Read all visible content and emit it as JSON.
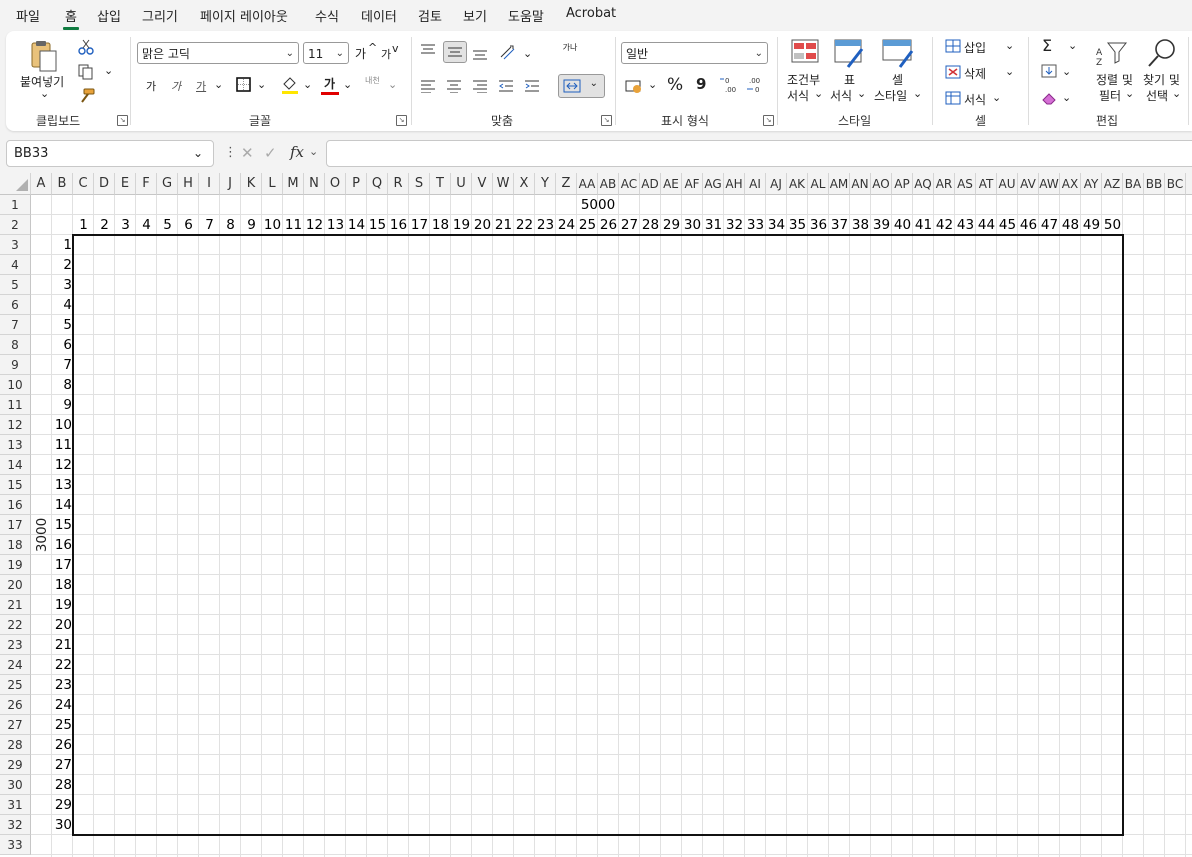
{
  "menu": {
    "tabs": [
      "파일",
      "홈",
      "삽입",
      "그리기",
      "페이지 레이아웃",
      "수식",
      "데이터",
      "검토",
      "보기",
      "도움말",
      "Acrobat"
    ],
    "active": "홈"
  },
  "ribbon": {
    "clipboard": {
      "paste_label": "붙여넣기",
      "group_label": "클립보드"
    },
    "font": {
      "font_name": "맑은 고딕",
      "font_size": "11",
      "bold": "가",
      "italic": "가",
      "underline": "가",
      "grow": "가",
      "shrink": "가",
      "color_glyph": "가",
      "phonetic": "내천",
      "group_label": "글꼴"
    },
    "alignment": {
      "wrap_glyph": "가나",
      "group_label": "맞춤"
    },
    "number": {
      "format": "일반",
      "percent": "%",
      "comma": "9",
      "group_label": "표시 형식"
    },
    "styles": {
      "conditional": [
        "조건부",
        "서식"
      ],
      "table": [
        "표",
        "서식"
      ],
      "cell": [
        "셀",
        "스타일"
      ],
      "group_label": "스타일"
    },
    "cells": {
      "insert": "삽입",
      "delete": "삭제",
      "format": "서식",
      "group_label": "셀"
    },
    "editing": {
      "sort": [
        "정렬 및",
        "필터"
      ],
      "find": [
        "찾기 및",
        "선택"
      ],
      "sum": "Σ",
      "group_label": "편집"
    }
  },
  "formula_bar": {
    "name_box": "BB33",
    "fx": "fx",
    "value": ""
  },
  "sheet": {
    "columns": [
      "A",
      "B",
      "C",
      "D",
      "E",
      "F",
      "G",
      "H",
      "I",
      "J",
      "K",
      "L",
      "M",
      "N",
      "O",
      "P",
      "Q",
      "R",
      "S",
      "T",
      "U",
      "V",
      "W",
      "X",
      "Y",
      "Z",
      "AA",
      "AB",
      "AC",
      "AD",
      "AE",
      "AF",
      "AG",
      "AH",
      "AI",
      "AJ",
      "AK",
      "AL",
      "AM",
      "AN",
      "AO",
      "AP",
      "AQ",
      "AR",
      "AS",
      "AT",
      "AU",
      "AV",
      "AW",
      "AX",
      "AY",
      "AZ",
      "BA",
      "BB",
      "BC",
      "B"
    ],
    "rows": [
      1,
      2,
      3,
      4,
      5,
      6,
      7,
      8,
      9,
      10,
      11,
      12,
      13,
      14,
      15,
      16,
      17,
      18,
      19,
      20,
      21,
      22,
      23,
      24,
      25,
      26,
      27,
      28,
      29,
      30,
      31,
      32,
      33
    ],
    "width_label": "5000",
    "height_label": "3000",
    "col_numbers": [
      1,
      2,
      3,
      4,
      5,
      6,
      7,
      8,
      9,
      10,
      11,
      12,
      13,
      14,
      15,
      16,
      17,
      18,
      19,
      20,
      21,
      22,
      23,
      24,
      25,
      26,
      27,
      28,
      29,
      30,
      31,
      32,
      33,
      34,
      35,
      36,
      37,
      38,
      39,
      40,
      41,
      42,
      43,
      44,
      45,
      46,
      47,
      48,
      49,
      50
    ],
    "row_numbers": [
      1,
      2,
      3,
      4,
      5,
      6,
      7,
      8,
      9,
      10,
      11,
      12,
      13,
      14,
      15,
      16,
      17,
      18,
      19,
      20,
      21,
      22,
      23,
      24,
      25,
      26,
      27,
      28,
      29,
      30
    ]
  }
}
